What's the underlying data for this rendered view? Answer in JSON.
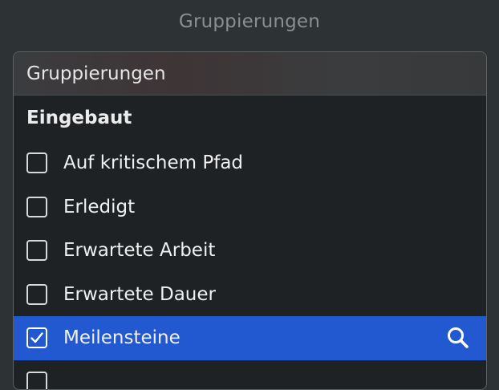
{
  "window": {
    "title": "Gruppierungen"
  },
  "dropdown": {
    "header_label": "Gruppierungen",
    "section_heading": "Eingebaut",
    "items": [
      {
        "label": "Auf kritischem Pfad",
        "checked": false,
        "selected": false
      },
      {
        "label": "Erledigt",
        "checked": false,
        "selected": false
      },
      {
        "label": "Erwartete Arbeit",
        "checked": false,
        "selected": false
      },
      {
        "label": "Erwartete Dauer",
        "checked": false,
        "selected": false
      },
      {
        "label": "Meilensteine",
        "checked": true,
        "selected": true
      },
      {
        "label": "",
        "checked": false,
        "selected": false
      }
    ]
  },
  "colors": {
    "background": "#2d3235",
    "panel": "#1e2224",
    "selection": "#2258d0",
    "text": "#f0f0f0",
    "muted_text": "#8a8f92"
  },
  "icons": {
    "search": "search-icon",
    "checkmark": "checkmark-icon"
  }
}
